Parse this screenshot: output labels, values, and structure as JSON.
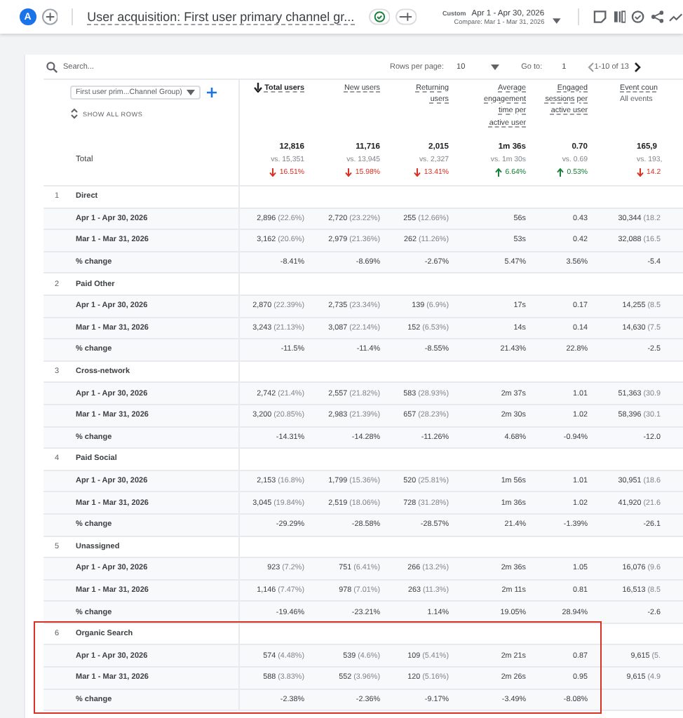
{
  "header": {
    "avatar": "A",
    "title": "User acquisition: First user primary channel gr...",
    "custom_label": "Custom",
    "date_range": "Apr 1 - Apr 30, 2026",
    "compare": "Compare: Mar 1 - Mar 31, 2026"
  },
  "toolbar": {
    "search_placeholder": "Search...",
    "rows_per_page_label": "Rows per page:",
    "rows_per_page": "10",
    "goto_label": "Go to:",
    "goto_value": "1",
    "page_range": "1-10 of 13"
  },
  "dimension": {
    "label": "First user prim...Channel Group)",
    "show_all": "SHOW ALL ROWS"
  },
  "columns": [
    {
      "label": "Total users",
      "sorted": true
    },
    {
      "label": "New users",
      "sorted": false
    },
    {
      "label": "Returning users",
      "sorted": false
    },
    {
      "label": "Average engagement time per active user",
      "sorted": false
    },
    {
      "label": "Engaged sessions per active user",
      "sorted": false
    },
    {
      "label": "Event coun",
      "sublabel": "All events",
      "sorted": false
    }
  ],
  "total": {
    "label": "Total",
    "cells": [
      {
        "value": "12,816",
        "compare": "vs. 15,351",
        "change": "16.51%",
        "increased": false
      },
      {
        "value": "11,716",
        "compare": "vs. 13,945",
        "change": "15.98%",
        "increased": false
      },
      {
        "value": "2,015",
        "compare": "vs. 2,327",
        "change": "13.41%",
        "increased": false
      },
      {
        "value": "1m 36s",
        "compare": "vs. 1m 30s",
        "change": "6.64%",
        "increased": true
      },
      {
        "value": "0.70",
        "compare": "vs. 0.69",
        "change": "0.53%",
        "increased": true
      },
      {
        "value": "165,9",
        "compare": "vs. 193,",
        "change": "14.2",
        "increased": false
      }
    ]
  },
  "groups": [
    {
      "rank": "1",
      "name": "Direct",
      "highlighted": false,
      "rows": [
        {
          "label": "Apr 1 - Apr 30, 2026",
          "cells": [
            {
              "value": "2,896",
              "share": "(22.6%)"
            },
            {
              "value": "2,720",
              "share": "(23.22%)"
            },
            {
              "value": "255",
              "share": "(12.66%)"
            },
            {
              "value": "56s"
            },
            {
              "value": "0.43"
            },
            {
              "value": "30,344",
              "share": "(18.2"
            }
          ]
        },
        {
          "label": "Mar 1 - Mar 31, 2026",
          "cells": [
            {
              "value": "3,162",
              "share": "(20.6%)"
            },
            {
              "value": "2,979",
              "share": "(21.36%)"
            },
            {
              "value": "262",
              "share": "(11.26%)"
            },
            {
              "value": "53s"
            },
            {
              "value": "0.42"
            },
            {
              "value": "32,088",
              "share": "(16.5"
            }
          ]
        },
        {
          "label": "% change",
          "cells": [
            {
              "value": "-8.41%"
            },
            {
              "value": "-8.69%"
            },
            {
              "value": "-2.67%"
            },
            {
              "value": "5.47%"
            },
            {
              "value": "3.56%"
            },
            {
              "value": "-5.4"
            }
          ]
        }
      ]
    },
    {
      "rank": "2",
      "name": "Paid Other",
      "highlighted": false,
      "rows": [
        {
          "label": "Apr 1 - Apr 30, 2026",
          "cells": [
            {
              "value": "2,870",
              "share": "(22.39%)"
            },
            {
              "value": "2,735",
              "share": "(23.34%)"
            },
            {
              "value": "139",
              "share": "(6.9%)"
            },
            {
              "value": "17s"
            },
            {
              "value": "0.17"
            },
            {
              "value": "14,255",
              "share": "(8.5"
            }
          ]
        },
        {
          "label": "Mar 1 - Mar 31, 2026",
          "cells": [
            {
              "value": "3,243",
              "share": "(21.13%)"
            },
            {
              "value": "3,087",
              "share": "(22.14%)"
            },
            {
              "value": "152",
              "share": "(6.53%)"
            },
            {
              "value": "14s"
            },
            {
              "value": "0.14"
            },
            {
              "value": "14,630",
              "share": "(7.5"
            }
          ]
        },
        {
          "label": "% change",
          "cells": [
            {
              "value": "-11.5%"
            },
            {
              "value": "-11.4%"
            },
            {
              "value": "-8.55%"
            },
            {
              "value": "21.43%"
            },
            {
              "value": "22.8%"
            },
            {
              "value": "-2.5"
            }
          ]
        }
      ]
    },
    {
      "rank": "3",
      "name": "Cross-network",
      "highlighted": false,
      "rows": [
        {
          "label": "Apr 1 - Apr 30, 2026",
          "cells": [
            {
              "value": "2,742",
              "share": "(21.4%)"
            },
            {
              "value": "2,557",
              "share": "(21.82%)"
            },
            {
              "value": "583",
              "share": "(28.93%)"
            },
            {
              "value": "2m 37s"
            },
            {
              "value": "1.01"
            },
            {
              "value": "51,363",
              "share": "(30.9"
            }
          ]
        },
        {
          "label": "Mar 1 - Mar 31, 2026",
          "cells": [
            {
              "value": "3,200",
              "share": "(20.85%)"
            },
            {
              "value": "2,983",
              "share": "(21.39%)"
            },
            {
              "value": "657",
              "share": "(28.23%)"
            },
            {
              "value": "2m 30s"
            },
            {
              "value": "1.02"
            },
            {
              "value": "58,396",
              "share": "(30.1"
            }
          ]
        },
        {
          "label": "% change",
          "cells": [
            {
              "value": "-14.31%"
            },
            {
              "value": "-14.28%"
            },
            {
              "value": "-11.26%"
            },
            {
              "value": "4.68%"
            },
            {
              "value": "-0.94%"
            },
            {
              "value": "-12.0"
            }
          ]
        }
      ]
    },
    {
      "rank": "4",
      "name": "Paid Social",
      "highlighted": false,
      "rows": [
        {
          "label": "Apr 1 - Apr 30, 2026",
          "cells": [
            {
              "value": "2,153",
              "share": "(16.8%)"
            },
            {
              "value": "1,799",
              "share": "(15.36%)"
            },
            {
              "value": "520",
              "share": "(25.81%)"
            },
            {
              "value": "1m 56s"
            },
            {
              "value": "1.01"
            },
            {
              "value": "30,951",
              "share": "(18.6"
            }
          ]
        },
        {
          "label": "Mar 1 - Mar 31, 2026",
          "cells": [
            {
              "value": "3,045",
              "share": "(19.84%)"
            },
            {
              "value": "2,519",
              "share": "(18.06%)"
            },
            {
              "value": "728",
              "share": "(31.28%)"
            },
            {
              "value": "1m 36s"
            },
            {
              "value": "1.02"
            },
            {
              "value": "41,920",
              "share": "(21.6"
            }
          ]
        },
        {
          "label": "% change",
          "cells": [
            {
              "value": "-29.29%"
            },
            {
              "value": "-28.58%"
            },
            {
              "value": "-28.57%"
            },
            {
              "value": "21.4%"
            },
            {
              "value": "-1.39%"
            },
            {
              "value": "-26.1"
            }
          ]
        }
      ]
    },
    {
      "rank": "5",
      "name": "Unassigned",
      "highlighted": false,
      "rows": [
        {
          "label": "Apr 1 - Apr 30, 2026",
          "cells": [
            {
              "value": "923",
              "share": "(7.2%)"
            },
            {
              "value": "751",
              "share": "(6.41%)"
            },
            {
              "value": "266",
              "share": "(13.2%)"
            },
            {
              "value": "2m 36s"
            },
            {
              "value": "1.05"
            },
            {
              "value": "16,076",
              "share": "(9.6"
            }
          ]
        },
        {
          "label": "Mar 1 - Mar 31, 2026",
          "cells": [
            {
              "value": "1,146",
              "share": "(7.47%)"
            },
            {
              "value": "978",
              "share": "(7.01%)"
            },
            {
              "value": "263",
              "share": "(11.3%)"
            },
            {
              "value": "2m 11s"
            },
            {
              "value": "0.81"
            },
            {
              "value": "16,513",
              "share": "(8.5"
            }
          ]
        },
        {
          "label": "% change",
          "cells": [
            {
              "value": "-19.46%"
            },
            {
              "value": "-23.21%"
            },
            {
              "value": "1.14%"
            },
            {
              "value": "19.05%"
            },
            {
              "value": "28.94%"
            },
            {
              "value": "-2.6"
            }
          ]
        }
      ]
    },
    {
      "rank": "6",
      "name": "Organic Search",
      "highlighted": true,
      "rows": [
        {
          "label": "Apr 1 - Apr 30, 2026",
          "cells": [
            {
              "value": "574",
              "share": "(4.48%)"
            },
            {
              "value": "539",
              "share": "(4.6%)"
            },
            {
              "value": "109",
              "share": "(5.41%)"
            },
            {
              "value": "2m 21s"
            },
            {
              "value": "0.87"
            },
            {
              "value": "9,615",
              "share": "(5."
            }
          ]
        },
        {
          "label": "Mar 1 - Mar 31, 2026",
          "cells": [
            {
              "value": "588",
              "share": "(3.83%)"
            },
            {
              "value": "552",
              "share": "(3.96%)"
            },
            {
              "value": "120",
              "share": "(5.16%)"
            },
            {
              "value": "2m 26s"
            },
            {
              "value": "0.95"
            },
            {
              "value": "9,615",
              "share": "(4.9"
            }
          ]
        },
        {
          "label": "% change",
          "cells": [
            {
              "value": "-2.38%"
            },
            {
              "value": "-2.36%"
            },
            {
              "value": "-9.17%"
            },
            {
              "value": "-3.49%"
            },
            {
              "value": "-8.08%"
            }
          ]
        }
      ]
    }
  ]
}
